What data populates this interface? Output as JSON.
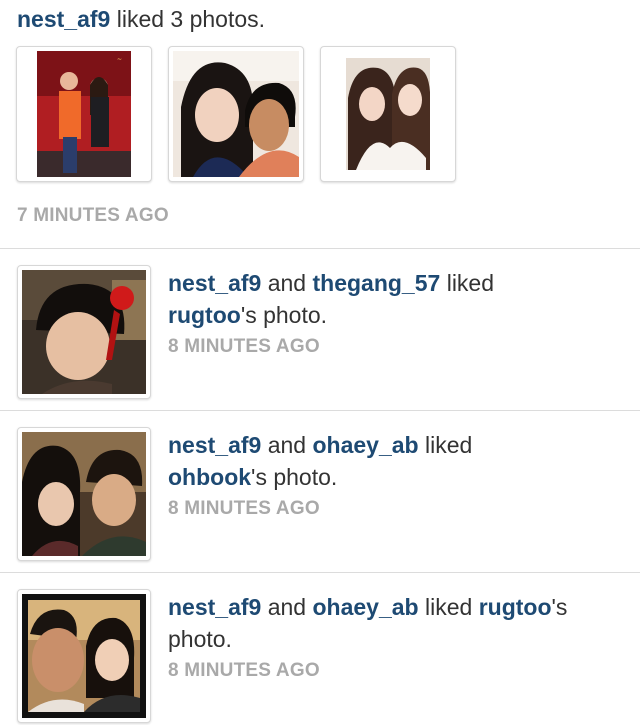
{
  "feed": {
    "top": {
      "user": "nest_af9",
      "action": " liked 3 photos.",
      "time": "7 MINUTES AGO"
    },
    "items": [
      {
        "user1": "nest_af9",
        "connector": " and ",
        "user2": "thegang_57",
        "liked": " liked",
        "owner": "rugtoo",
        "suffix": "'s photo.",
        "time": "8 MINUTES AGO"
      },
      {
        "user1": "nest_af9",
        "connector": " and ",
        "user2": "ohaey_ab",
        "liked": " liked",
        "owner": "ohbook",
        "suffix": "'s photo.",
        "time": "8 MINUTES AGO"
      },
      {
        "user1": "nest_af9",
        "connector": " and ",
        "user2": "ohaey_ab",
        "liked": " liked ",
        "owner": "rugtoo",
        "suffix": "'s photo.",
        "time": "8 MINUTES AGO"
      }
    ]
  }
}
